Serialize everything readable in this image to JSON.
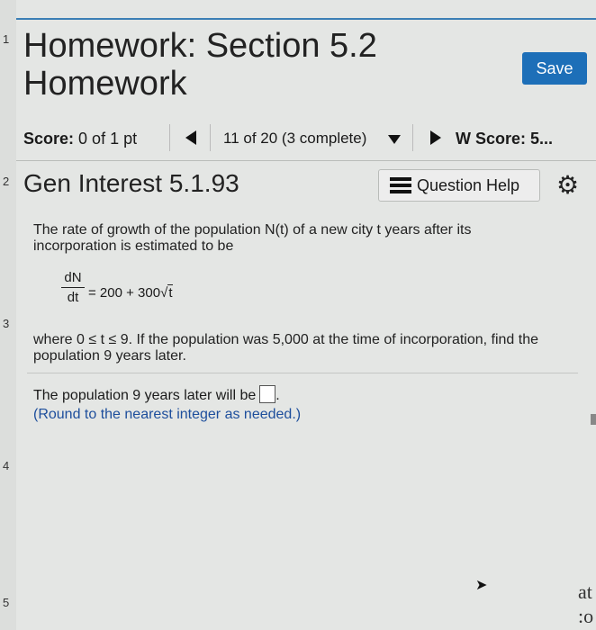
{
  "gutter": [
    "1",
    "2",
    "3",
    "4",
    "5"
  ],
  "header": {
    "title": "Homework: Section 5.2 Homework",
    "save_label": "Save"
  },
  "nav": {
    "score_label": "Score:",
    "score_value": "0 of 1 pt",
    "progress": "11 of 20 (3 complete)",
    "hw_score": "W Score: 5..."
  },
  "question": {
    "title": "Gen Interest 5.1.93",
    "help_label": "Question Help",
    "intro_line1": "The rate of growth of the population N(t) of a new city t years after its",
    "intro_line2": "incorporation is estimated to be",
    "eq_num": "dN",
    "eq_den": "dt",
    "eq_rhs": "= 200 + 300",
    "eq_rad": "t",
    "cond_line1": "where 0 ≤ t ≤ 9. If the population was 5,000 at the time of incorporation, find the",
    "cond_line2": "population 9 years later.",
    "answer_prefix": "The population 9 years later will be",
    "answer_value": "",
    "answer_suffix": ".",
    "hint": "(Round to the nearest integer as needed.)"
  },
  "edge_text": [
    "at",
    ":o"
  ]
}
